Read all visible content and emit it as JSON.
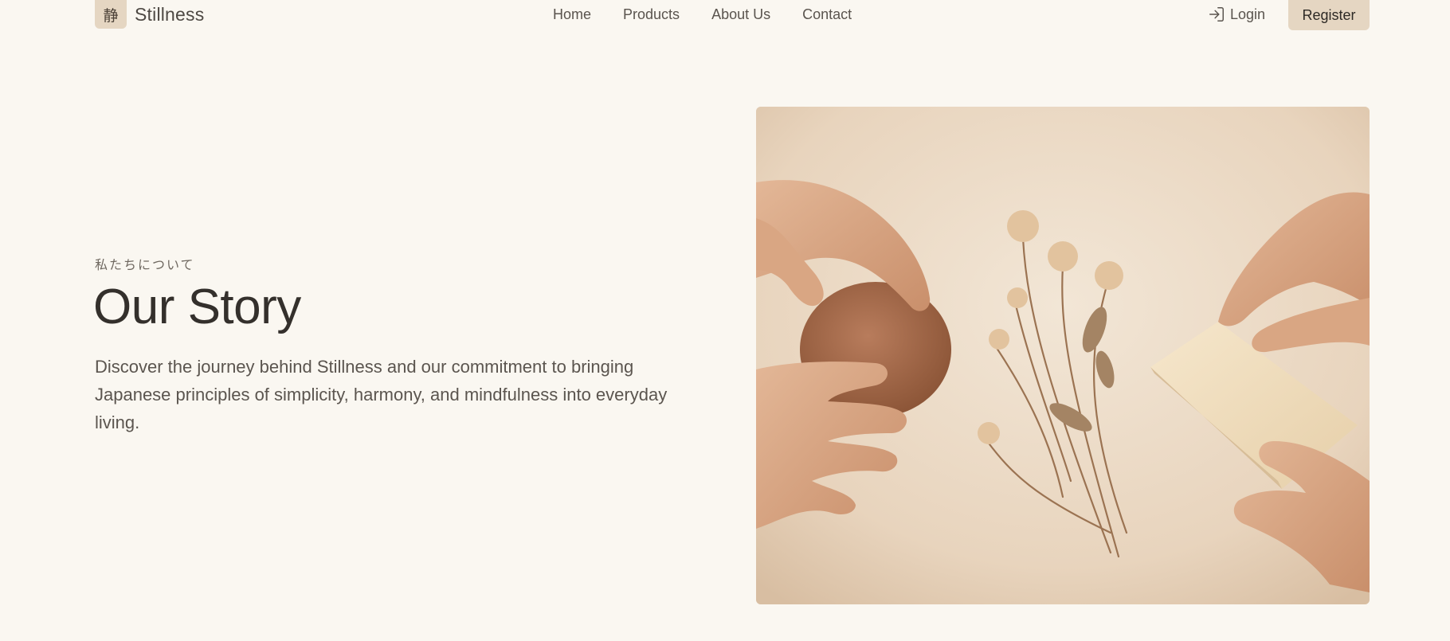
{
  "brand": {
    "mark": "静",
    "name": "Stillness"
  },
  "nav": {
    "items": [
      {
        "label": "Home"
      },
      {
        "label": "Products"
      },
      {
        "label": "About Us"
      },
      {
        "label": "Contact"
      }
    ],
    "login_label": "Login",
    "register_label": "Register"
  },
  "hero": {
    "eyebrow": "私たちについて",
    "title": "Our Story",
    "description": "Discover the journey behind Stillness and our commitment to bringing Japanese principles of simplicity, harmony, and mindfulness into everyday living.",
    "image_icon": "hands-clay-flowers-paper-photo"
  },
  "colors": {
    "background": "#faf7f1",
    "accent": "#e5d6c2",
    "text": "#34302c"
  },
  "icons": {
    "login": "login-arrow-icon"
  }
}
